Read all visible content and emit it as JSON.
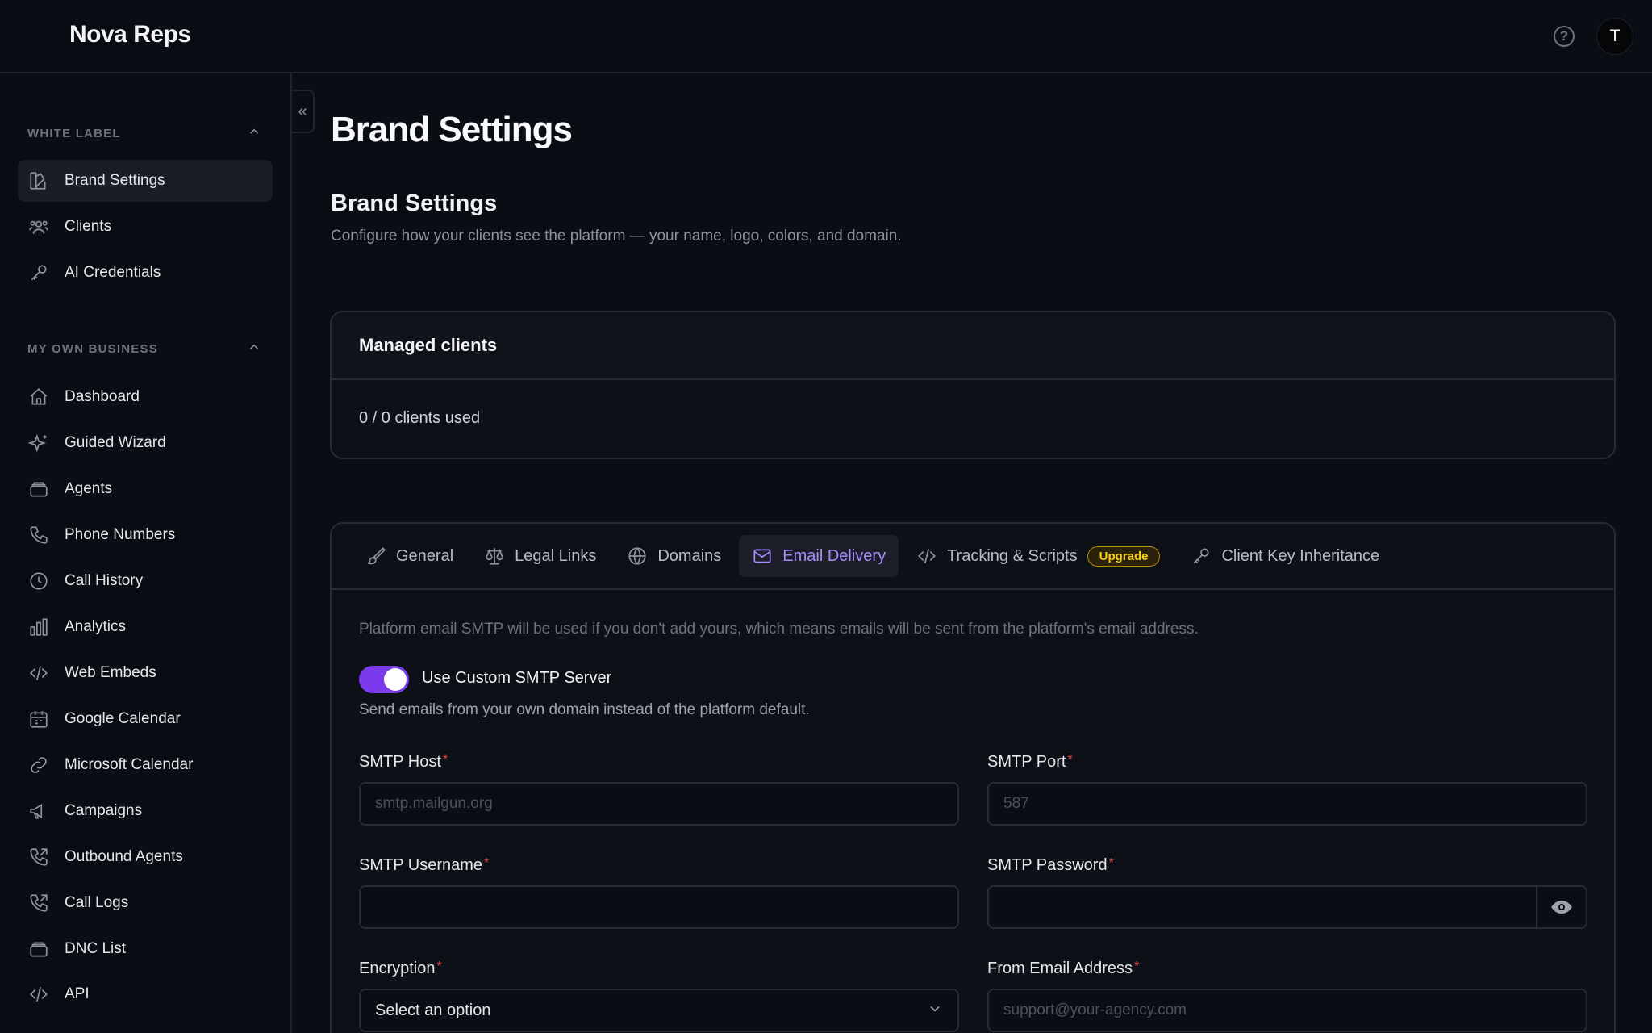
{
  "header": {
    "brand": "Nova Reps",
    "help_icon_glyph": "?",
    "avatar_initial": "T"
  },
  "sidebar": {
    "collapse_glyph": "«",
    "sections": [
      {
        "title": "WHITE LABEL",
        "items": [
          {
            "label": "Brand Settings",
            "icon": "brand-icon",
            "active": true
          },
          {
            "label": "Clients",
            "icon": "users-icon"
          },
          {
            "label": "AI Credentials",
            "icon": "key-icon"
          }
        ]
      },
      {
        "title": "MY OWN BUSINESS",
        "items": [
          {
            "label": "Dashboard",
            "icon": "home-icon"
          },
          {
            "label": "Guided Wizard",
            "icon": "sparkles-icon"
          },
          {
            "label": "Agents",
            "icon": "stack-icon"
          },
          {
            "label": "Phone Numbers",
            "icon": "phone-icon"
          },
          {
            "label": "Call History",
            "icon": "clock-icon"
          },
          {
            "label": "Analytics",
            "icon": "bar-chart-icon"
          },
          {
            "label": "Web Embeds",
            "icon": "code-icon"
          },
          {
            "label": "Google Calendar",
            "icon": "calendar-icon"
          },
          {
            "label": "Microsoft Calendar",
            "icon": "link-icon"
          },
          {
            "label": "Campaigns",
            "icon": "megaphone-icon"
          },
          {
            "label": "Outbound Agents",
            "icon": "phone-outgoing-icon"
          },
          {
            "label": "Call Logs",
            "icon": "phone-outgoing-icon"
          },
          {
            "label": "DNC List",
            "icon": "stack-icon"
          },
          {
            "label": "API",
            "icon": "code-icon"
          }
        ]
      }
    ]
  },
  "main": {
    "page_title": "Brand Settings",
    "section_title": "Brand Settings",
    "section_desc": "Configure how your clients see the platform — your name, logo, colors, and domain.",
    "managed_clients": {
      "title": "Managed clients",
      "usage": "0 / 0 clients used"
    },
    "tabs": [
      {
        "label": "General",
        "icon": "brush-icon"
      },
      {
        "label": "Legal Links",
        "icon": "scale-icon"
      },
      {
        "label": "Domains",
        "icon": "globe-icon"
      },
      {
        "label": "Email Delivery",
        "icon": "mail-icon",
        "active": true
      },
      {
        "label": "Tracking & Scripts",
        "icon": "code-icon",
        "badge": "Upgrade"
      },
      {
        "label": "Client Key Inheritance",
        "icon": "key-icon"
      }
    ],
    "email": {
      "note": "Platform email SMTP will be used if you don't add yours, which means emails will be sent from the platform's email address.",
      "toggle_label": "Use Custom SMTP Server",
      "toggle_on": true,
      "toggle_desc": "Send emails from your own domain instead of the platform default.",
      "required_mark": "*",
      "smtp_host": {
        "label": "SMTP Host",
        "placeholder": "smtp.mailgun.org",
        "value": ""
      },
      "smtp_port": {
        "label": "SMTP Port",
        "placeholder": "587",
        "value": ""
      },
      "smtp_username": {
        "label": "SMTP Username",
        "placeholder": "",
        "value": ""
      },
      "smtp_password": {
        "label": "SMTP Password",
        "placeholder": "",
        "value": ""
      },
      "encryption": {
        "label": "Encryption",
        "selected": "Select an option"
      },
      "from_email": {
        "label": "From Email Address",
        "placeholder": "support@your-agency.com",
        "value": ""
      }
    }
  },
  "colors": {
    "background": "#0b0d14",
    "accent": "#7c3aed",
    "accent_text": "#a78bfa",
    "badge": "#facc15",
    "required": "#ef4444"
  }
}
